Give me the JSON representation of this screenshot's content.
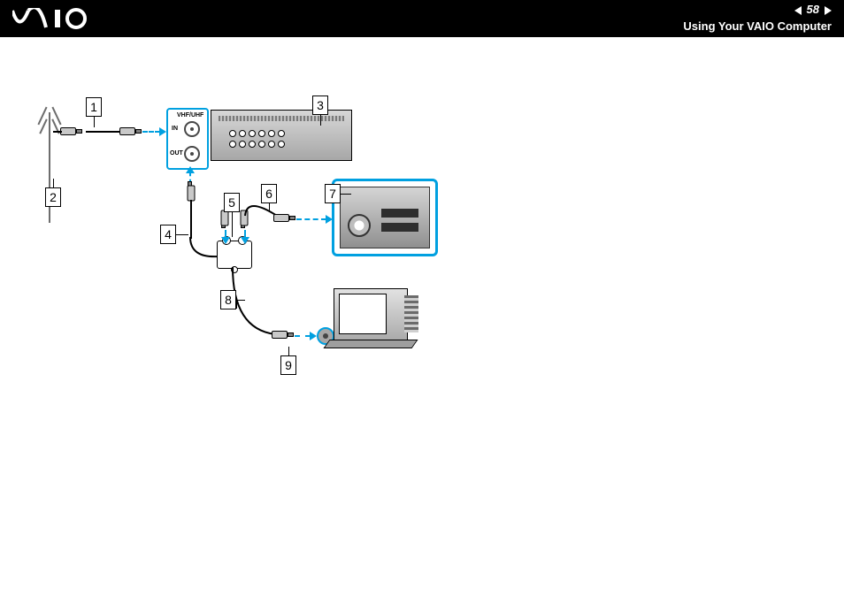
{
  "header": {
    "brand": "VAIO",
    "page_number": "58",
    "section_title": "Using Your VAIO Computer"
  },
  "tuner_panel": {
    "title": "VHF/UHF",
    "in_label": "IN",
    "out_label": "OUT"
  },
  "callouts": {
    "c1": "1",
    "c2": "2",
    "c3": "3",
    "c4": "4",
    "c5": "5",
    "c6": "6",
    "c7": "7",
    "c8": "8",
    "c9": "9"
  }
}
